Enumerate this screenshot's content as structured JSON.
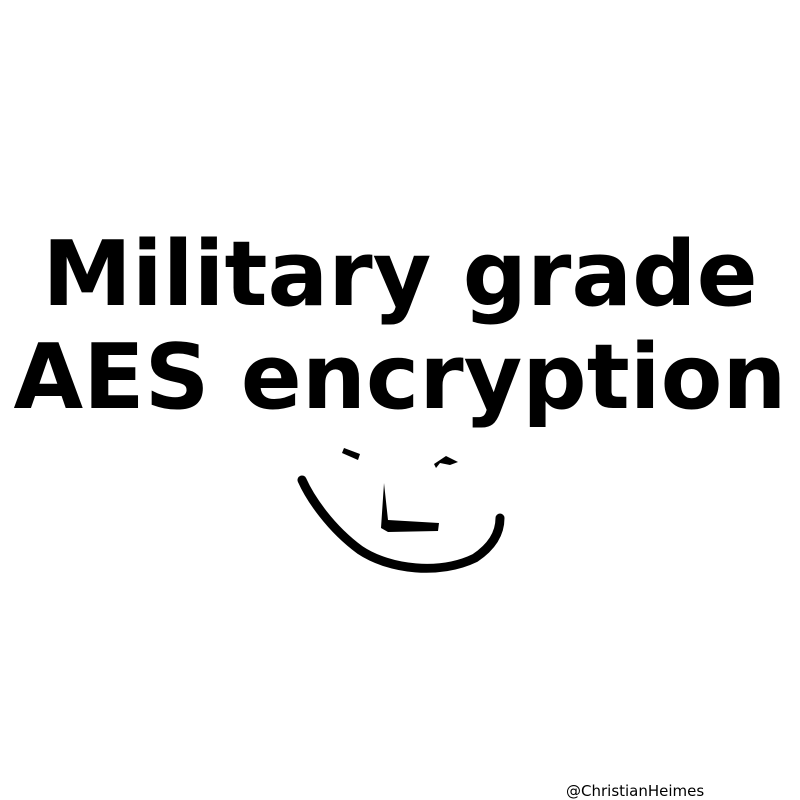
{
  "headline": {
    "line1": "Military grade",
    "line2": "AES encryption"
  },
  "face": {
    "icon": "smiley-face-icon",
    "color": "#000000"
  },
  "credit": {
    "handle": "@ChristianHeimes"
  },
  "colors": {
    "background": "#ffffff",
    "text": "#000000"
  }
}
